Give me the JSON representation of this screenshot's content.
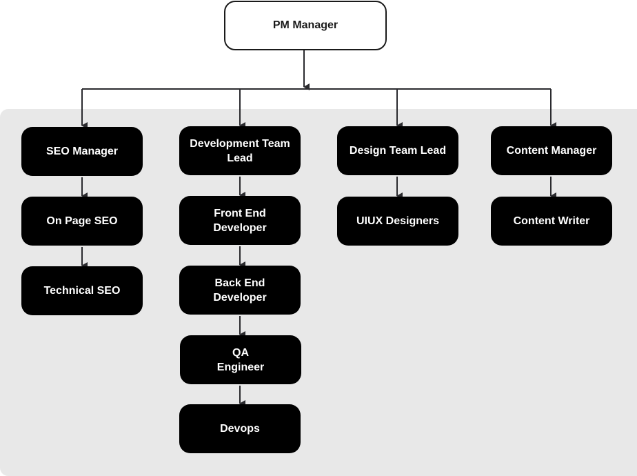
{
  "root": {
    "label": "PM Manager"
  },
  "columns": [
    {
      "nodes": [
        {
          "label": "SEO Manager"
        },
        {
          "label": "On Page SEO"
        },
        {
          "label": "Technical SEO"
        }
      ]
    },
    {
      "nodes": [
        {
          "label": "Development Team Lead"
        },
        {
          "label": "Front End Developer"
        },
        {
          "label": "Back End Developer"
        },
        {
          "label": "QA Engineer"
        },
        {
          "label": "Devops"
        }
      ]
    },
    {
      "nodes": [
        {
          "label": "Design Team Lead"
        },
        {
          "label": "UIUX Designers"
        }
      ]
    },
    {
      "nodes": [
        {
          "label": "Content Manager"
        },
        {
          "label": "Content Writer"
        }
      ]
    }
  ],
  "colors": {
    "node_fill": "#000000",
    "node_text": "#ffffff",
    "panel": "#e8e8e8",
    "line": "#2a2a2e"
  }
}
